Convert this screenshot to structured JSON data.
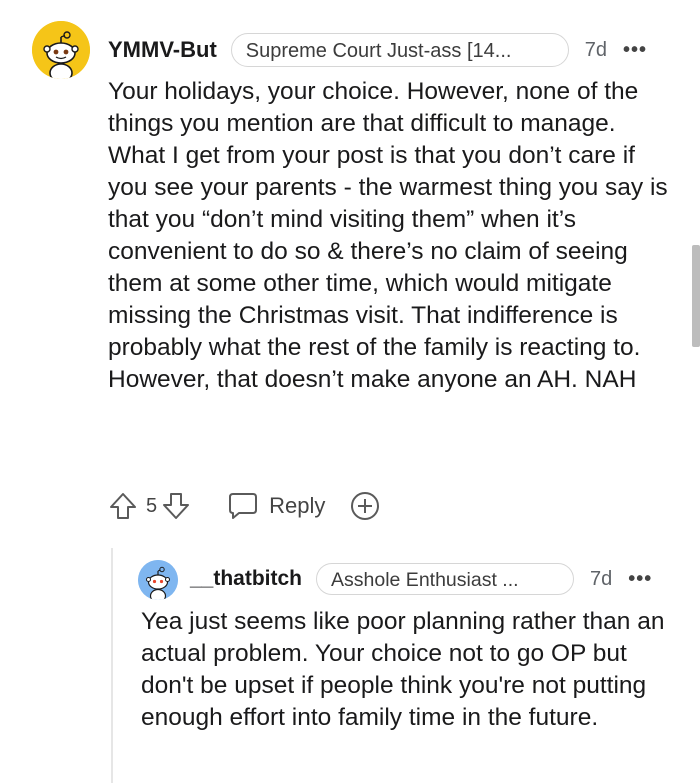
{
  "comment": {
    "username": "YMMV-But",
    "flair": "Supreme Court Just-ass [14...",
    "age": "7d",
    "more": "•••",
    "body": "Your holidays, your choice. However, none of the things you mention are that difficult to manage. What I get from your post is that you don’t care if you see your parents - the warmest thing you say is that you “don’t mind visiting them” when it’s convenient to do so & there’s no claim of seeing them at some other time, which would mitigate missing the Christmas visit. That indifference is probably what the rest of the family is reacting to. However, that doesn’t make anyone an AH. NAH",
    "votes": "5",
    "reply_label": "Reply",
    "avatar_color": "#f5c518"
  },
  "reply": {
    "username": "__thatbitch",
    "flair": "Asshole Enthusiast ...",
    "age": "7d",
    "more": "•••",
    "body": "Yea just seems like poor planning rather than an actual problem. Your choice not to go OP but don't be upset if people think you're not putting enough effort into family time in the future.",
    "avatar_color": "#7fb6f0"
  },
  "icons": {
    "upvote": "upvote-icon",
    "downvote": "downvote-icon",
    "reply": "speech-bubble-icon",
    "expand": "plus-circle-icon",
    "more": "more-options-icon"
  }
}
